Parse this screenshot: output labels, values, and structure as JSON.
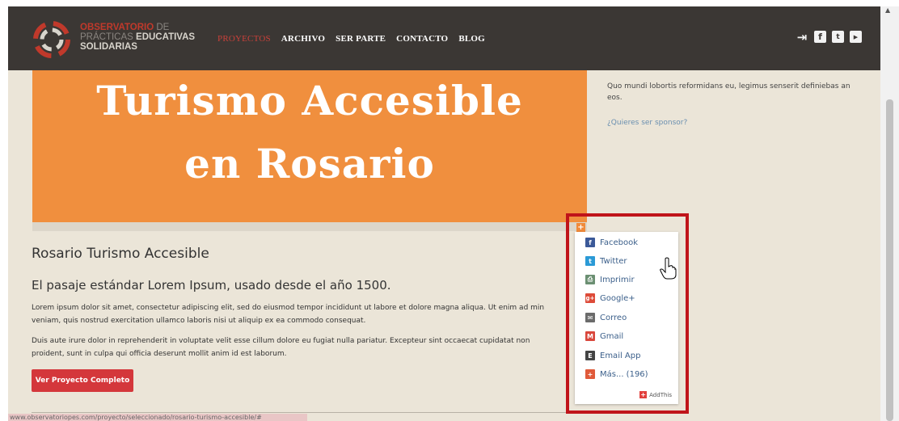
{
  "logo": {
    "line1_bold": "OBSERVATORIO",
    "line1_rest": "DE",
    "line2_normal": "PRÁCTICAS",
    "line2_bold": "EDUCATIVAS",
    "line3": "SOLIDARIAS"
  },
  "nav": {
    "items": [
      {
        "label": "PROYECTOS",
        "active": true
      },
      {
        "label": "ARCHIVO",
        "active": false
      },
      {
        "label": "SER PARTE",
        "active": false
      },
      {
        "label": "CONTACTO",
        "active": false
      },
      {
        "label": "BLOG",
        "active": false
      }
    ],
    "icons": [
      "login-icon",
      "facebook-icon",
      "twitter-icon",
      "youtube-icon"
    ]
  },
  "hero": {
    "line1": "Turismo Accesible",
    "line2": "en Rosario",
    "bg_color": "#f08f3e"
  },
  "project": {
    "title": "Rosario Turismo Accesible",
    "subtitle": "El pasaje estándar Lorem Ipsum, usado desde el año 1500.",
    "para1_line1": "Lorem ipsum dolor sit amet, consectetur adipiscing elit, sed do eiusmod tempor incididunt ut labore et dolore magna aliqua. Ut enim ad min",
    "para1_line2": "veniam, quis nostrud exercitation ullamco laboris nisi ut aliquip ex ea commodo consequat.",
    "para2_line1": "Duis aute irure dolor in reprehenderit in voluptate velit esse cillum dolore eu fugiat nulla pariatur. Excepteur sint occaecat cupidatat non",
    "para2_line2": "proident, sunt in culpa qui officia deserunt mollit anim id est laborum.",
    "cta_label": "Ver Proyecto Completo",
    "cta_color": "#d4373b"
  },
  "sidebar": {
    "text_line1": "Quo mundi lobortis reformidans eu, legimus senserit definiebas an",
    "text_line2": "eos.",
    "sponsor_link": "¿Quieres ser sponsor?"
  },
  "share_menu": {
    "items": [
      {
        "label": "Facebook",
        "icon": "facebook-icon",
        "color": "#3b5998",
        "glyph": "f"
      },
      {
        "label": "Twitter",
        "icon": "twitter-icon",
        "color": "#2b9ad6",
        "glyph": "t"
      },
      {
        "label": "Imprimir",
        "icon": "print-icon",
        "color": "#6b8f72",
        "glyph": "p"
      },
      {
        "label": "Google+",
        "icon": "google-plus-icon",
        "color": "#dd4b39",
        "glyph": "g+"
      },
      {
        "label": "Correo",
        "icon": "mail-icon",
        "color": "#6b6b6b",
        "glyph": "@"
      },
      {
        "label": "Gmail",
        "icon": "gmail-icon",
        "color": "#d9473c",
        "glyph": "M"
      },
      {
        "label": "Email App",
        "icon": "email-app-icon",
        "color": "#444444",
        "glyph": "E"
      },
      {
        "label": "Más... (196)",
        "icon": "more-icon",
        "color": "#e05a3a",
        "glyph": "+"
      }
    ],
    "footer": "AddThis",
    "highlight_color": "#c0141a"
  },
  "status_bar": {
    "url": "www.observatoriopes.com/proyecto/seleccionado/rosario-turismo-accesible/#"
  }
}
